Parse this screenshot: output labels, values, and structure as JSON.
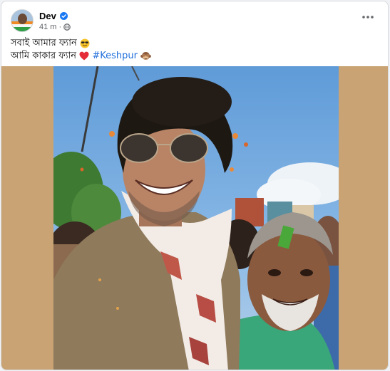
{
  "post": {
    "author": "Dev",
    "timestamp": "41 m",
    "separator": "·",
    "privacy_icon": "globe-icon",
    "more_icon": "ellipsis-icon",
    "verified_icon": "verified-badge-icon",
    "caption_line1_text": "সবাই আমার ফ্যান",
    "caption_line1_emoji": "smiling-face-with-sunglasses",
    "caption_line2_text": "আমি কাকার ফ্যান",
    "caption_line2_heart": "red-heart",
    "hashtag": "#Keshpur",
    "caption_line2_emoji": "see-no-evil-monkey"
  },
  "colors": {
    "hashtag": "#216fdb",
    "verified": "#1877f2",
    "media_background": "#c9a373",
    "secondary_text": "#65676b"
  }
}
